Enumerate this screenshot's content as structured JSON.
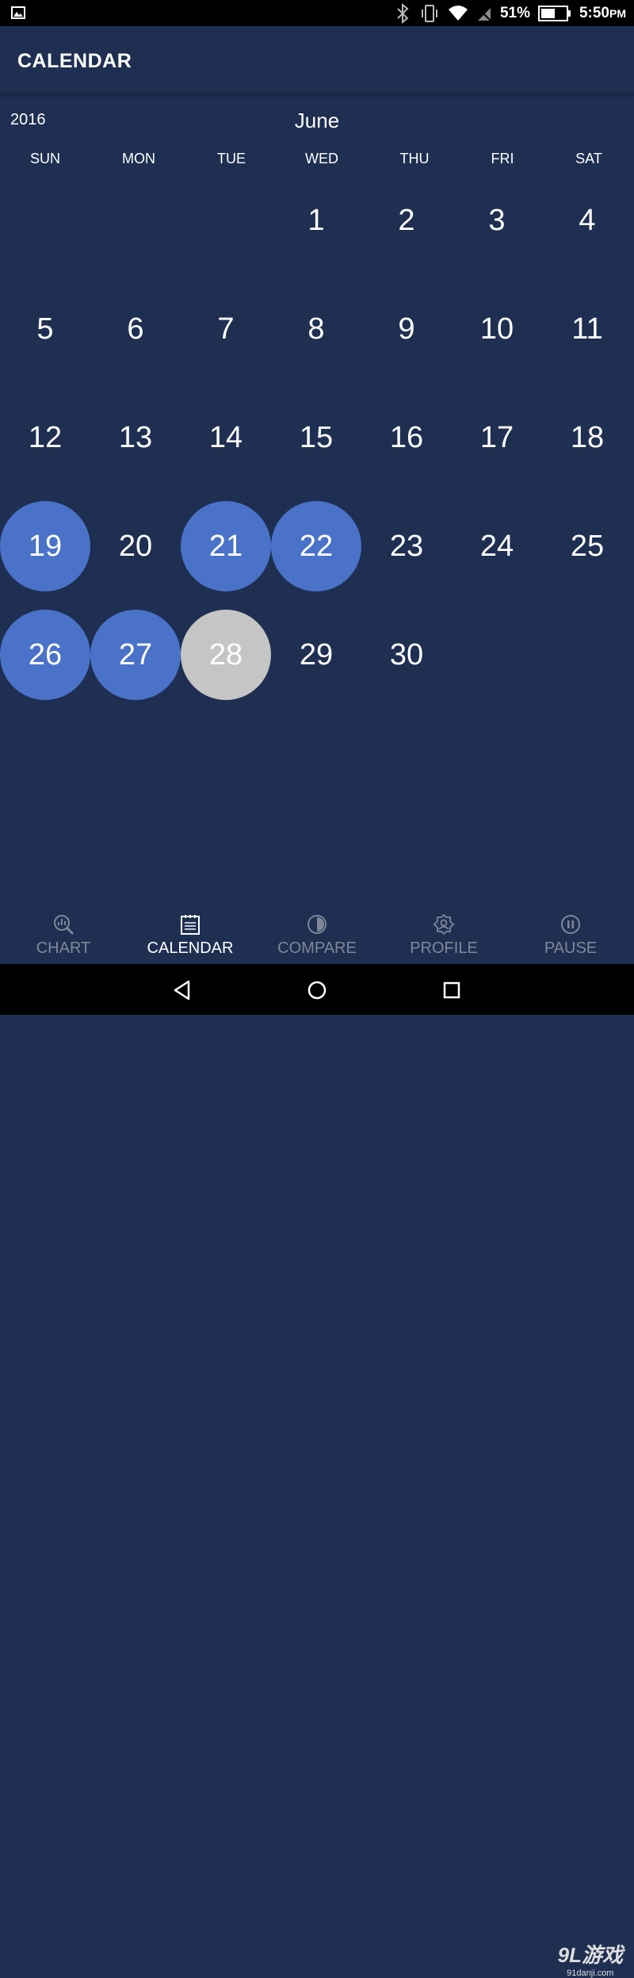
{
  "status_bar": {
    "battery": "51%",
    "time": "5:50",
    "ampm": "PM",
    "icons": [
      "image-icon",
      "bluetooth-icon",
      "vibrate-icon",
      "wifi-icon",
      "no-signal-icon",
      "battery-icon"
    ]
  },
  "app_bar": {
    "title": "CALENDAR"
  },
  "calendar": {
    "year": "2016",
    "month": "June",
    "weekdays": [
      "SUN",
      "MON",
      "TUE",
      "WED",
      "THU",
      "FRI",
      "SAT"
    ],
    "days": [
      {
        "label": "1",
        "col": 3,
        "row": 0,
        "state": "normal"
      },
      {
        "label": "2",
        "col": 4,
        "row": 0,
        "state": "normal"
      },
      {
        "label": "3",
        "col": 5,
        "row": 0,
        "state": "normal"
      },
      {
        "label": "4",
        "col": 6,
        "row": 0,
        "state": "normal"
      },
      {
        "label": "5",
        "col": 0,
        "row": 1,
        "state": "normal"
      },
      {
        "label": "6",
        "col": 1,
        "row": 1,
        "state": "normal"
      },
      {
        "label": "7",
        "col": 2,
        "row": 1,
        "state": "normal"
      },
      {
        "label": "8",
        "col": 3,
        "row": 1,
        "state": "normal"
      },
      {
        "label": "9",
        "col": 4,
        "row": 1,
        "state": "normal"
      },
      {
        "label": "10",
        "col": 5,
        "row": 1,
        "state": "normal"
      },
      {
        "label": "11",
        "col": 6,
        "row": 1,
        "state": "normal"
      },
      {
        "label": "12",
        "col": 0,
        "row": 2,
        "state": "normal"
      },
      {
        "label": "13",
        "col": 1,
        "row": 2,
        "state": "normal"
      },
      {
        "label": "14",
        "col": 2,
        "row": 2,
        "state": "normal"
      },
      {
        "label": "15",
        "col": 3,
        "row": 2,
        "state": "normal"
      },
      {
        "label": "16",
        "col": 4,
        "row": 2,
        "state": "normal"
      },
      {
        "label": "17",
        "col": 5,
        "row": 2,
        "state": "normal"
      },
      {
        "label": "18",
        "col": 6,
        "row": 2,
        "state": "normal"
      },
      {
        "label": "19",
        "col": 0,
        "row": 3,
        "state": "selected"
      },
      {
        "label": "20",
        "col": 1,
        "row": 3,
        "state": "normal"
      },
      {
        "label": "21",
        "col": 2,
        "row": 3,
        "state": "selected"
      },
      {
        "label": "22",
        "col": 3,
        "row": 3,
        "state": "selected"
      },
      {
        "label": "23",
        "col": 4,
        "row": 3,
        "state": "normal"
      },
      {
        "label": "24",
        "col": 5,
        "row": 3,
        "state": "normal"
      },
      {
        "label": "25",
        "col": 6,
        "row": 3,
        "state": "normal"
      },
      {
        "label": "26",
        "col": 0,
        "row": 4,
        "state": "selected"
      },
      {
        "label": "27",
        "col": 1,
        "row": 4,
        "state": "selected"
      },
      {
        "label": "28",
        "col": 2,
        "row": 4,
        "state": "today"
      },
      {
        "label": "29",
        "col": 3,
        "row": 4,
        "state": "normal"
      },
      {
        "label": "30",
        "col": 4,
        "row": 4,
        "state": "normal"
      }
    ]
  },
  "bottom_nav": {
    "items": [
      {
        "label": "CHART",
        "icon": "chart-search-icon",
        "active": false
      },
      {
        "label": "CALENDAR",
        "icon": "calendar-icon",
        "active": true
      },
      {
        "label": "COMPARE",
        "icon": "compare-icon",
        "active": false
      },
      {
        "label": "PROFILE",
        "icon": "profile-icon",
        "active": false
      },
      {
        "label": "PAUSE",
        "icon": "pause-icon",
        "active": false
      }
    ]
  },
  "system_nav": {
    "icons": [
      "back-icon",
      "home-icon",
      "recents-icon"
    ]
  },
  "watermark": {
    "brand": "9L游戏",
    "site": "91danji.com"
  },
  "colors": {
    "background": "#1e2f52",
    "selected": "#4a72c9",
    "today": "#c5c5c5",
    "nav_inactive": "#7e8898"
  }
}
